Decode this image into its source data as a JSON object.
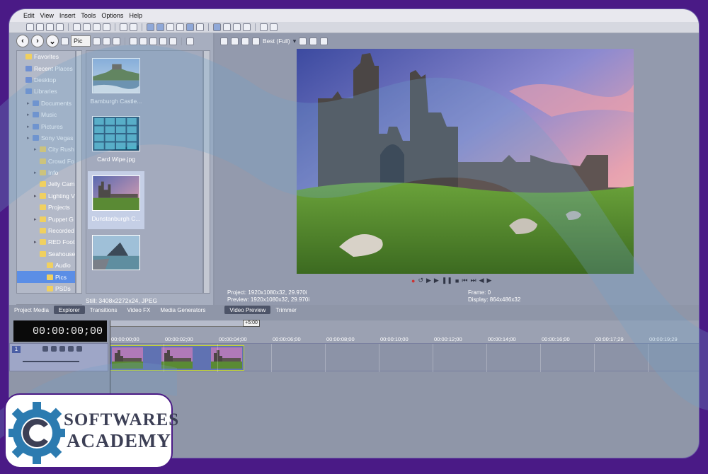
{
  "menu": [
    "Edit",
    "View",
    "Insert",
    "Tools",
    "Options",
    "Help"
  ],
  "explorer": {
    "path": "Pic",
    "tree": [
      {
        "label": "Favorites",
        "icon": "star-folder-icon",
        "depth": 0,
        "color": "yellow"
      },
      {
        "label": "Recent Places",
        "icon": "recent-places-icon",
        "depth": 0,
        "color": "blue"
      },
      {
        "label": "Desktop",
        "icon": "desktop-icon",
        "depth": 0,
        "color": "blue"
      },
      {
        "label": "Libraries",
        "icon": "libraries-icon",
        "depth": 0,
        "color": "blue"
      },
      {
        "label": "Documents",
        "icon": "documents-icon",
        "depth": 1,
        "color": "blue"
      },
      {
        "label": "Music",
        "icon": "music-icon",
        "depth": 1,
        "color": "blue"
      },
      {
        "label": "Pictures",
        "icon": "pictures-icon",
        "depth": 1,
        "color": "blue"
      },
      {
        "label": "Sony Vegas",
        "icon": "folder-icon",
        "depth": 1,
        "color": "blue"
      },
      {
        "label": "City Rush",
        "icon": "folder-icon",
        "depth": 2,
        "color": "yellow"
      },
      {
        "label": "Crowd Fo",
        "icon": "folder-icon",
        "depth": 2,
        "color": "yellow"
      },
      {
        "label": "Info",
        "icon": "folder-icon",
        "depth": 2,
        "color": "yellow"
      },
      {
        "label": "Jelly Cam",
        "icon": "folder-icon",
        "depth": 2,
        "color": "yellow"
      },
      {
        "label": "Lighting V",
        "icon": "folder-icon",
        "depth": 2,
        "color": "yellow"
      },
      {
        "label": "Projects",
        "icon": "folder-icon",
        "depth": 2,
        "color": "yellow"
      },
      {
        "label": "Puppet G",
        "icon": "folder-icon",
        "depth": 2,
        "color": "yellow"
      },
      {
        "label": "Recorded",
        "icon": "folder-icon",
        "depth": 2,
        "color": "yellow"
      },
      {
        "label": "RED Foot",
        "icon": "folder-icon",
        "depth": 2,
        "color": "yellow"
      },
      {
        "label": "Seahouse",
        "icon": "folder-icon",
        "depth": 2,
        "color": "yellow"
      },
      {
        "label": "Audio",
        "icon": "folder-icon",
        "depth": 3,
        "color": "yellow"
      },
      {
        "label": "Pics",
        "icon": "folder-icon",
        "depth": 3,
        "color": "yellow",
        "selected": true
      },
      {
        "label": "PSDs",
        "icon": "folder-icon",
        "depth": 3,
        "color": "yellow"
      }
    ],
    "files": [
      {
        "label": "Bamburgh Castle...",
        "selected": false
      },
      {
        "label": "Card Wipe.jpg",
        "selected": false
      },
      {
        "label": "Dunstanburgh C...",
        "selected": true
      },
      {
        "label": "",
        "selected": false
      }
    ],
    "still_info": "Still: 3408x2272x24, JPEG"
  },
  "tabs_left": [
    "Project Media",
    "Explorer",
    "Transitions",
    "Video FX",
    "Media Generators"
  ],
  "tabs_left_active": "Explorer",
  "tabs_right": [
    "Video Preview",
    "Trimmer"
  ],
  "tabs_right_active": "Video Preview",
  "preview": {
    "quality": "Best (Full)",
    "project_label": "Project:",
    "project_value": "1920x1080x32, 29.970i",
    "preview_label": "Preview:",
    "preview_value": "1920x1080x32, 29.970i",
    "frame_label": "Frame:",
    "frame_value": "0",
    "display_label": "Display:",
    "display_value": "864x486x32"
  },
  "timeline": {
    "timecode": "00:00:00;00",
    "loop_length": "+5:00",
    "ticks": [
      "00:00:00;00",
      "00:00:02;00",
      "00:00:04;00",
      "00:00:06;00",
      "00:00:08;00",
      "00:00:10;00",
      "00:00:12;00",
      "00:00:14;00",
      "00:00:16;00",
      "00:00:17;29",
      "00:00:19;29"
    ],
    "track_number": "1"
  },
  "logo": {
    "line1": "SOFTWARES",
    "line2": "ACADEMY"
  },
  "colors": {
    "border": "#4a1a86",
    "app_bg": "#8f96a8",
    "clip_border": "#c7d830",
    "wave": "#6fa0c8"
  }
}
